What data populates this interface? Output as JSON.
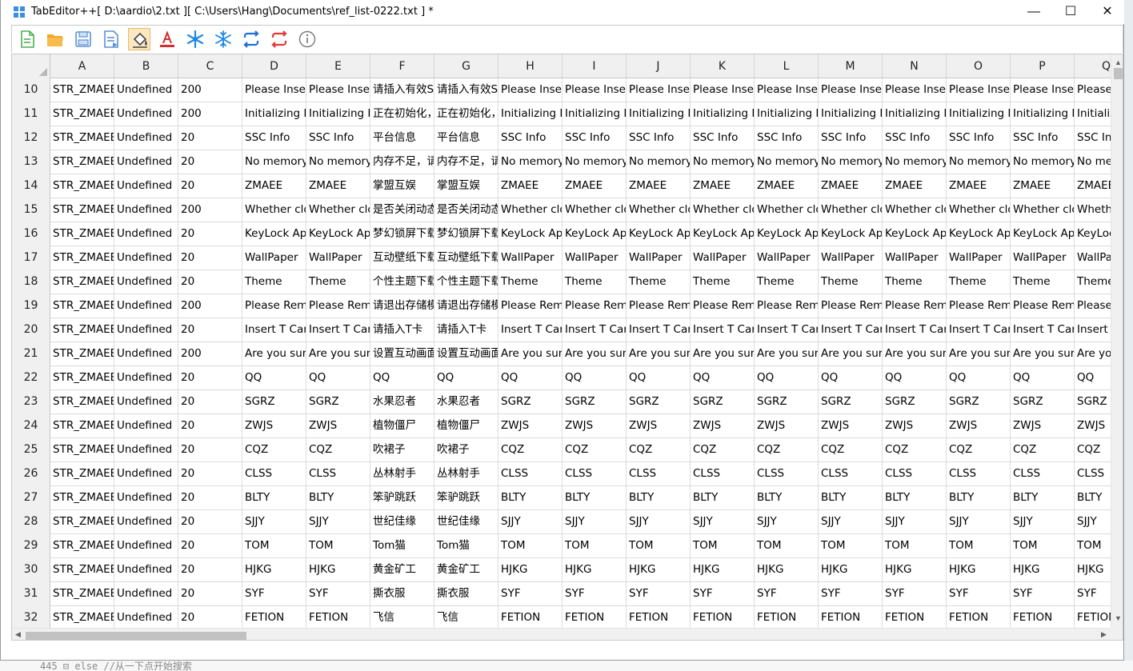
{
  "window": {
    "title": "TabEditor++[ D:\\aardio\\2.txt ][ C:\\Users\\Hang\\Documents\\ref_list-0222.txt ] *",
    "minimize": "—",
    "maximize": "☐",
    "close": "✕"
  },
  "toolbar": {
    "buttons": [
      {
        "name": "new-file-icon",
        "color": "#4caf50"
      },
      {
        "name": "open-folder-icon",
        "color": "#f5a623"
      },
      {
        "name": "save-icon",
        "color": "#5b8fd6"
      },
      {
        "name": "save-as-icon",
        "color": "#5b8fd6"
      },
      {
        "name": "fill-bucket-icon",
        "color": "#555555"
      },
      {
        "name": "text-color-icon",
        "color": "#d32f2f"
      },
      {
        "name": "freeze-icon",
        "color": "#1e88e5"
      },
      {
        "name": "unfreeze-icon",
        "color": "#1e88e5"
      },
      {
        "name": "swap-blue-icon",
        "color": "#1e6fd6"
      },
      {
        "name": "swap-red-icon",
        "color": "#e53935"
      },
      {
        "name": "info-icon",
        "color": "#777777"
      }
    ]
  },
  "grid": {
    "columns": [
      "A",
      "B",
      "C",
      "D",
      "E",
      "F",
      "G",
      "H",
      "I",
      "J",
      "K",
      "L",
      "M",
      "N",
      "O",
      "P",
      "Q"
    ],
    "rows": [
      {
        "n": "10",
        "a": "STR_ZMAEE_",
        "b": "Undefined",
        "c": "200",
        "d": "Please Insert",
        "e": "Please Insert",
        "f": "请插入有效SI",
        "g": "请插入有效SI",
        "rest": "Please Insert",
        "q": "Please"
      },
      {
        "n": "11",
        "a": "STR_ZMAEE_",
        "b": "Undefined",
        "c": "200",
        "d": "Initializing N",
        "e": "Initializing N",
        "f": "正在初始化，",
        "g": "正在初始化，",
        "rest": "Initializing N",
        "q": "Initializiz"
      },
      {
        "n": "12",
        "a": "STR_ZMAEE_",
        "b": "Undefined",
        "c": "20",
        "d": "SSC Info",
        "e": "SSC Info",
        "f": "平台信息",
        "g": "平台信息",
        "rest": "SSC Info",
        "q": "SSC In"
      },
      {
        "n": "13",
        "a": "STR_ZMAEE_",
        "b": "Undefined",
        "c": "20",
        "d": "No memory,",
        "e": "No memory,",
        "f": "内存不足，请",
        "g": "内存不足，请",
        "rest": "No memory,",
        "q": "No me"
      },
      {
        "n": "14",
        "a": "STR_ZMAEE_",
        "b": "Undefined",
        "c": "20",
        "d": "ZMAEE",
        "e": "ZMAEE",
        "f": "掌盟互娱",
        "g": "掌盟互娱",
        "rest": "ZMAEE",
        "q": "ZMAEE"
      },
      {
        "n": "15",
        "a": "STR_ZMAEE_",
        "b": "Undefined",
        "c": "200",
        "d": "Whether clo",
        "e": "Whether clo",
        "f": "是否关闭动态",
        "g": "是否关闭动态",
        "rest": "Whether clo",
        "q": "Wheth"
      },
      {
        "n": "16",
        "a": "STR_ZMAEE_",
        "b": "Undefined",
        "c": "20",
        "d": "KeyLock App",
        "e": "KeyLock App",
        "f": "梦幻锁屏下载",
        "g": "梦幻锁屏下载",
        "rest": "KeyLock App",
        "q": "KeyLoc"
      },
      {
        "n": "17",
        "a": "STR_ZMAEE_",
        "b": "Undefined",
        "c": "20",
        "d": "WallPaper",
        "e": "WallPaper",
        "f": "互动壁纸下载",
        "g": "互动壁纸下载",
        "rest": "WallPaper",
        "q": "WallPa"
      },
      {
        "n": "18",
        "a": "STR_ZMAEE_",
        "b": "Undefined",
        "c": "20",
        "d": "Theme",
        "e": "Theme",
        "f": "个性主题下载",
        "g": "个性主题下载",
        "rest": "Theme",
        "q": "Theme"
      },
      {
        "n": "19",
        "a": "STR_ZMAEE_",
        "b": "Undefined",
        "c": "200",
        "d": "Please Remo",
        "e": "Please Remo",
        "f": "请退出存储模",
        "g": "请退出存储模",
        "rest": "Please Remo",
        "q": "Please"
      },
      {
        "n": "20",
        "a": "STR_ZMAEE_",
        "b": "Undefined",
        "c": "20",
        "d": "Insert T Card",
        "e": "Insert T Card",
        "f": "请插入T卡",
        "g": "请插入T卡",
        "rest": "Insert T Card",
        "q": "Insert T"
      },
      {
        "n": "21",
        "a": "STR_ZMAEE_",
        "b": "Undefined",
        "c": "200",
        "d": "Are you sure",
        "e": "Are you sure",
        "f": "设置互动画面",
        "g": "设置互动画面",
        "rest": "Are you sure",
        "q": "Are yo"
      },
      {
        "n": "22",
        "a": "STR_ZMAEE_",
        "b": "Undefined",
        "c": "20",
        "d": "QQ",
        "e": "QQ",
        "f": "QQ",
        "g": "QQ",
        "rest": "QQ",
        "q": "QQ"
      },
      {
        "n": "23",
        "a": "STR_ZMAEE_",
        "b": "Undefined",
        "c": "20",
        "d": "SGRZ",
        "e": "SGRZ",
        "f": "水果忍者",
        "g": "水果忍者",
        "rest": "SGRZ",
        "q": "SGRZ"
      },
      {
        "n": "24",
        "a": "STR_ZMAEE_",
        "b": "Undefined",
        "c": "20",
        "d": "ZWJS",
        "e": "ZWJS",
        "f": "植物僵尸",
        "g": "植物僵尸",
        "rest": "ZWJS",
        "q": "ZWJS"
      },
      {
        "n": "25",
        "a": "STR_ZMAEE_",
        "b": "Undefined",
        "c": "20",
        "d": "CQZ",
        "e": "CQZ",
        "f": "吹裙子",
        "g": "吹裙子",
        "rest": "CQZ",
        "q": "CQZ"
      },
      {
        "n": "26",
        "a": "STR_ZMAEE_",
        "b": "Undefined",
        "c": "20",
        "d": "CLSS",
        "e": "CLSS",
        "f": "丛林射手",
        "g": "丛林射手",
        "rest": "CLSS",
        "q": "CLSS"
      },
      {
        "n": "27",
        "a": "STR_ZMAEE_",
        "b": "Undefined",
        "c": "20",
        "d": "BLTY",
        "e": "BLTY",
        "f": "笨驴跳跃",
        "g": "笨驴跳跃",
        "rest": "BLTY",
        "q": "BLTY"
      },
      {
        "n": "28",
        "a": "STR_ZMAEE_",
        "b": "Undefined",
        "c": "20",
        "d": "SJJY",
        "e": "SJJY",
        "f": "世纪佳缘",
        "g": "世纪佳缘",
        "rest": "SJJY",
        "q": "SJJY"
      },
      {
        "n": "29",
        "a": "STR_ZMAEE_",
        "b": "Undefined",
        "c": "20",
        "d": "TOM",
        "e": "TOM",
        "f": "Tom猫",
        "g": "Tom猫",
        "rest": "TOM",
        "q": "TOM"
      },
      {
        "n": "30",
        "a": "STR_ZMAEE_",
        "b": "Undefined",
        "c": "20",
        "d": "HJKG",
        "e": "HJKG",
        "f": "黄金矿工",
        "g": "黄金矿工",
        "rest": "HJKG",
        "q": "HJKG"
      },
      {
        "n": "31",
        "a": "STR_ZMAEE_",
        "b": "Undefined",
        "c": "20",
        "d": "SYF",
        "e": "SYF",
        "f": "撕衣服",
        "g": "撕衣服",
        "rest": "SYF",
        "q": "SYF"
      },
      {
        "n": "32",
        "a": "STR_ZMAEE_",
        "b": "Undefined",
        "c": "20",
        "d": "FETION",
        "e": "FETION",
        "f": "飞信",
        "g": "飞信",
        "rest": "FETION",
        "q": "FETION"
      }
    ]
  },
  "background_window": {
    "text": "445  ⊟        else //从一下点开始搜索"
  }
}
